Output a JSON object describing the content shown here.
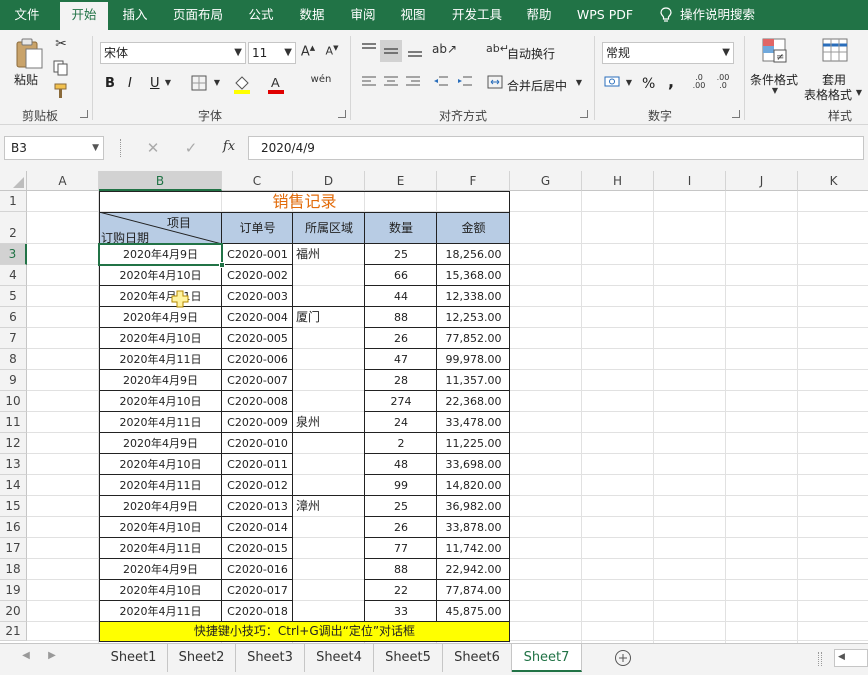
{
  "menu_tabs": [
    "文件",
    "开始",
    "插入",
    "页面布局",
    "公式",
    "数据",
    "审阅",
    "视图",
    "开发工具",
    "帮助",
    "WPS PDF",
    "操作说明搜索"
  ],
  "active_tab": "开始",
  "ribbon": {
    "clipboard": {
      "paste": "粘贴",
      "label": "剪贴板"
    },
    "font": {
      "name": "宋体",
      "size": "11",
      "bold": "B",
      "italic": "I",
      "underline": "U",
      "label": "字体"
    },
    "alignment": {
      "wrap": "自动换行",
      "merge": "合并后居中",
      "label": "对齐方式"
    },
    "number": {
      "format": "常规",
      "percent": "%",
      "comma": ",",
      "label": "数字"
    },
    "styles": {
      "conditional": "条件格式",
      "table_format": [
        "套用",
        "表格格式"
      ],
      "label": "样式"
    }
  },
  "formula_bar": {
    "name_box": "B3",
    "fx": "fx",
    "value": "2020/4/9"
  },
  "columns": [
    "A",
    "B",
    "C",
    "D",
    "E",
    "F",
    "G",
    "H",
    "I",
    "J",
    "K"
  ],
  "rows": [
    "1",
    "2",
    "3",
    "4",
    "5",
    "6",
    "7",
    "8",
    "9",
    "10",
    "11",
    "12",
    "13",
    "14",
    "15",
    "16",
    "17",
    "18",
    "19",
    "20",
    "21"
  ],
  "sheet": {
    "title": "销售记录",
    "diag_top": "项目",
    "diag_bottom": "订购日期",
    "headers": [
      "订单号",
      "所属区域",
      "数量",
      "金额"
    ],
    "data": [
      [
        "2020年4月9日",
        "C2020-001",
        "福州",
        "25",
        "18,256.00"
      ],
      [
        "2020年4月10日",
        "C2020-002",
        "",
        "66",
        "15,368.00"
      ],
      [
        "2020年4月11日",
        "C2020-003",
        "",
        "44",
        "12,338.00"
      ],
      [
        "2020年4月9日",
        "C2020-004",
        "厦门",
        "88",
        "12,253.00"
      ],
      [
        "2020年4月10日",
        "C2020-005",
        "",
        "26",
        "77,852.00"
      ],
      [
        "2020年4月11日",
        "C2020-006",
        "",
        "47",
        "99,978.00"
      ],
      [
        "2020年4月9日",
        "C2020-007",
        "",
        "28",
        "11,357.00"
      ],
      [
        "2020年4月10日",
        "C2020-008",
        "",
        "274",
        "22,368.00"
      ],
      [
        "2020年4月11日",
        "C2020-009",
        "泉州",
        "24",
        "33,478.00"
      ],
      [
        "2020年4月9日",
        "C2020-010",
        "",
        "2",
        "11,225.00"
      ],
      [
        "2020年4月10日",
        "C2020-011",
        "",
        "48",
        "33,698.00"
      ],
      [
        "2020年4月11日",
        "C2020-012",
        "",
        "99",
        "14,820.00"
      ],
      [
        "2020年4月9日",
        "C2020-013",
        "漳州",
        "25",
        "36,982.00"
      ],
      [
        "2020年4月10日",
        "C2020-014",
        "",
        "26",
        "33,878.00"
      ],
      [
        "2020年4月11日",
        "C2020-015",
        "",
        "77",
        "11,742.00"
      ],
      [
        "2020年4月9日",
        "C2020-016",
        "",
        "88",
        "22,942.00"
      ],
      [
        "2020年4月10日",
        "C2020-017",
        "",
        "22",
        "77,874.00"
      ],
      [
        "2020年4月11日",
        "C2020-018",
        "",
        "33",
        "45,875.00"
      ]
    ],
    "tip": "快捷键小技巧：Ctrl+G调出“定位”对话框"
  },
  "sheet_tabs": [
    "Sheet1",
    "Sheet2",
    "Sheet3",
    "Sheet4",
    "Sheet5",
    "Sheet6",
    "Sheet7"
  ],
  "active_sheet": "Sheet7",
  "colors": {
    "brand": "#217346",
    "header_fill": "#b8cce4",
    "title": "#e26b0a",
    "tip_fill": "#ffff00"
  }
}
